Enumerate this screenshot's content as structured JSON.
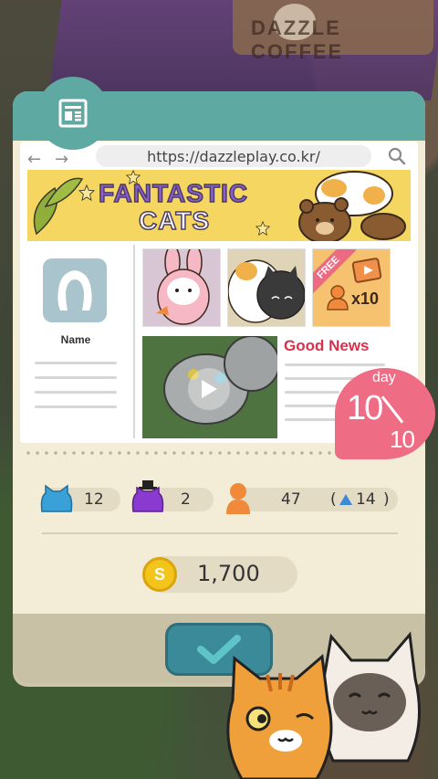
{
  "background": {
    "sign_text": "DAZZLE COFFEE"
  },
  "browser": {
    "url": "https://dazzleplay.co.kr/",
    "banner_line1": "FANTASTIC",
    "banner_line2": "CATS"
  },
  "profile": {
    "name_label": "Name"
  },
  "news": {
    "headline": "Good News",
    "free_label": "FREE",
    "reward_multiplier": "x10"
  },
  "day": {
    "label": "day",
    "current": "10",
    "total": "10"
  },
  "stats": {
    "blue_cats": "12",
    "purple_cats": "2",
    "visitors": "47",
    "visitors_delta": "14"
  },
  "coins": {
    "amount": "1,700",
    "symbol": "S"
  },
  "colors": {
    "teal": "#5fa9a3",
    "panel": "#f3ecd6",
    "banner_yellow": "#f5d660",
    "day_badge": "#ef6c85",
    "headline_red": "#d8314b"
  }
}
